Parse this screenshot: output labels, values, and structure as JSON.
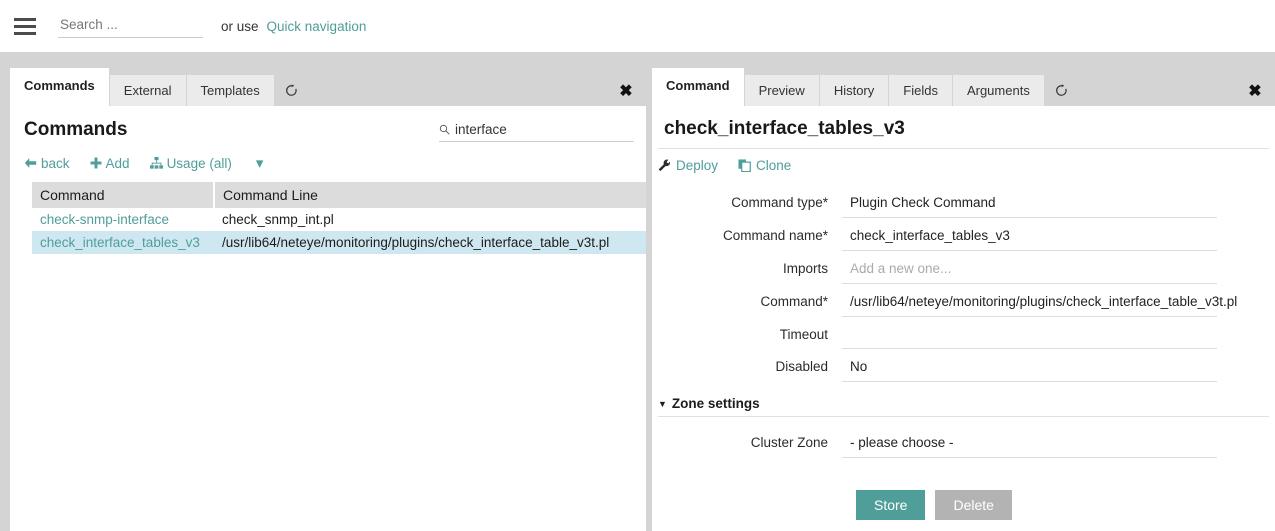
{
  "topbar": {
    "search_placeholder": "Search ...",
    "or_use": "or use",
    "quick_navigation": "Quick navigation"
  },
  "left_panel": {
    "tabs": [
      {
        "label": "Commands",
        "active": true
      },
      {
        "label": "External",
        "active": false
      },
      {
        "label": "Templates",
        "active": false
      }
    ],
    "title": "Commands",
    "filter_value": "interface",
    "actions": [
      {
        "label": "back",
        "icon": "arrow-left-icon"
      },
      {
        "label": "Add",
        "icon": "plus-icon"
      },
      {
        "label": "Usage (all)",
        "icon": "sitemap-icon"
      }
    ],
    "table": {
      "columns": [
        "Command",
        "Command Line"
      ],
      "rows": [
        {
          "command": "check-snmp-interface",
          "command_line": "check_snmp_int.pl",
          "selected": false
        },
        {
          "command": "check_interface_tables_v3",
          "command_line": "/usr/lib64/neteye/monitoring/plugins/check_interface_table_v3t.pl",
          "selected": true
        }
      ]
    }
  },
  "right_panel": {
    "tabs": [
      {
        "label": "Command",
        "active": true
      },
      {
        "label": "Preview",
        "active": false
      },
      {
        "label": "History",
        "active": false
      },
      {
        "label": "Fields",
        "active": false
      },
      {
        "label": "Arguments",
        "active": false
      }
    ],
    "title": "check_interface_tables_v3",
    "actions": [
      {
        "label": "Deploy",
        "icon": "wrench-icon"
      },
      {
        "label": "Clone",
        "icon": "copy-icon"
      }
    ],
    "form": {
      "fields": [
        {
          "label": "Command type*",
          "value": "Plugin Check Command",
          "placeholder": false
        },
        {
          "label": "Command name*",
          "value": "check_interface_tables_v3",
          "placeholder": false
        },
        {
          "label": "Imports",
          "value": "Add a new one...",
          "placeholder": true
        },
        {
          "label": "Command*",
          "value": "/usr/lib64/neteye/monitoring/plugins/check_interface_table_v3t.pl",
          "placeholder": false
        },
        {
          "label": "Timeout",
          "value": "",
          "placeholder": false
        },
        {
          "label": "Disabled",
          "value": "No",
          "placeholder": false
        }
      ],
      "zone_section_title": "Zone settings",
      "zone_fields": [
        {
          "label": "Cluster Zone",
          "value": "- please choose -",
          "placeholder": false
        }
      ]
    },
    "buttons": {
      "store": "Store",
      "delete": "Delete"
    }
  },
  "colors": {
    "accent_teal": "#4f9e9a",
    "selected_row": "#cfe7f0",
    "chrome_gray": "#d4d4d4",
    "delete_gray": "#b3b3b3"
  }
}
